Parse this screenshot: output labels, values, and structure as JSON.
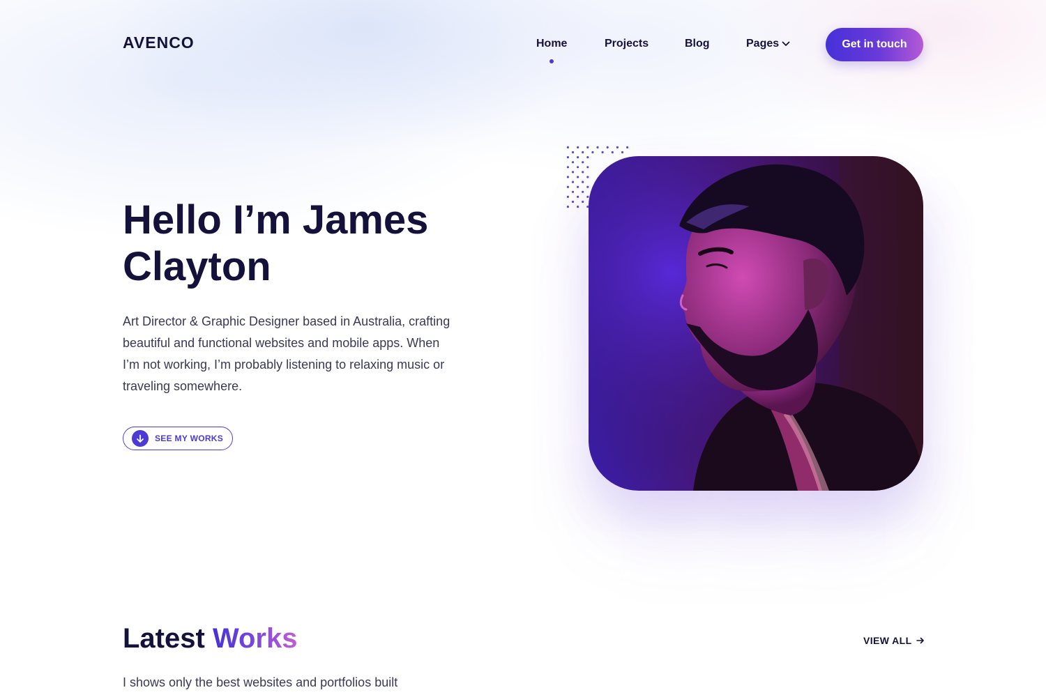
{
  "brand": {
    "logo": "AVENCO"
  },
  "nav": {
    "items": [
      {
        "label": "Home",
        "active": true
      },
      {
        "label": "Projects",
        "active": false
      },
      {
        "label": "Blog",
        "active": false
      },
      {
        "label": "Pages",
        "active": false,
        "has_dropdown": true
      }
    ],
    "cta_label": "Get in touch"
  },
  "hero": {
    "title": "Hello I’m James Clayton",
    "description": "Art Director & Graphic Designer based in Australia, crafting beautiful and functional websites and mobile apps. When I’m not working, I’m probably listening to relaxing music or traveling somewhere.",
    "button_label": "SEE MY WORKS",
    "button_icon": "arrow-down-icon",
    "photo_icon": "profile-photo"
  },
  "latest_works": {
    "title_plain": "Latest ",
    "title_accent": "Works",
    "view_all_label": "VIEW ALL",
    "description": "I shows only the best websites and portfolios built"
  },
  "colors": {
    "primary": "#4b3ad6",
    "gradient_start": "#4631d8",
    "gradient_end": "#b45ad6",
    "heading": "#14123a",
    "body_text": "#3a3858"
  }
}
